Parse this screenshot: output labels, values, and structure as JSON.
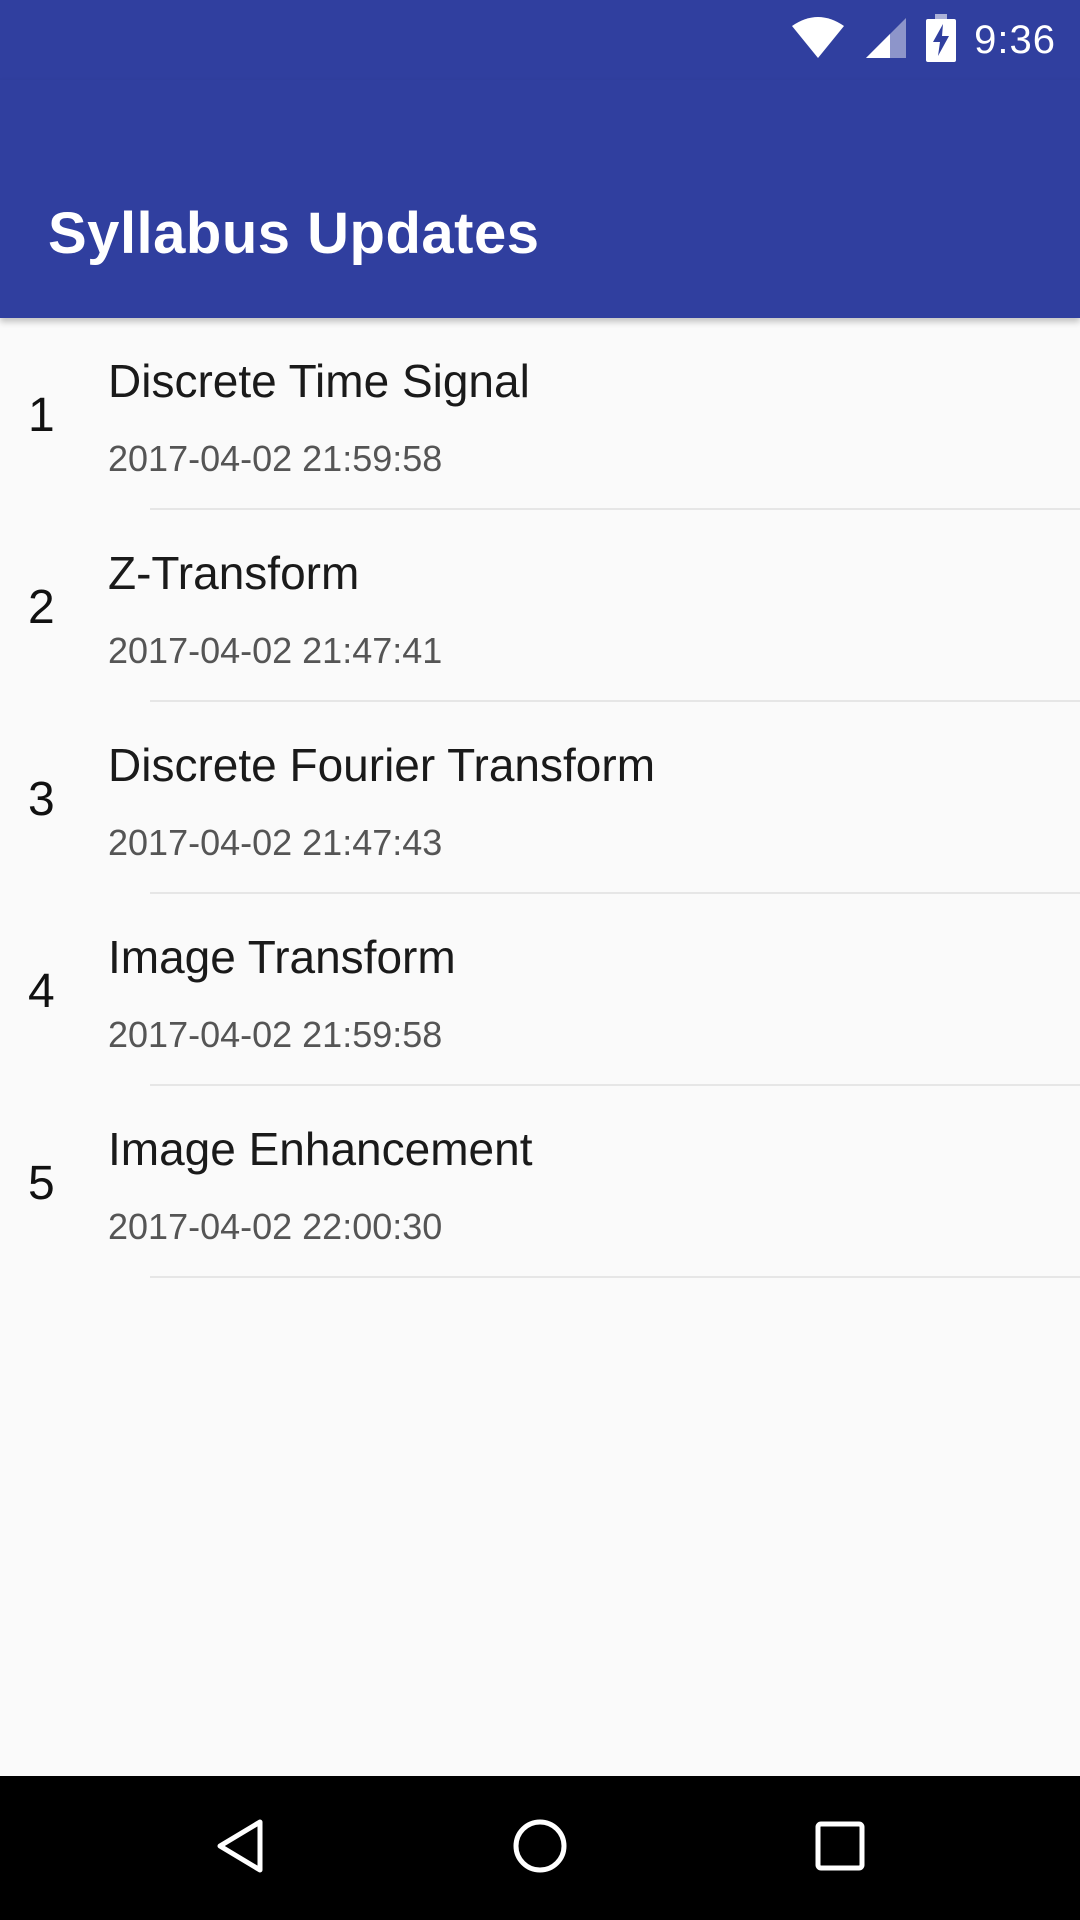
{
  "status_bar": {
    "time": "9:36",
    "icons": [
      "wifi-icon",
      "signal-icon",
      "battery-charging-icon"
    ]
  },
  "app_bar": {
    "title": "Syllabus Updates"
  },
  "items": [
    {
      "index": "1",
      "title": "Discrete Time Signal",
      "date": "2017-04-02 21:59:58"
    },
    {
      "index": "2",
      "title": "Z-Transform",
      "date": "2017-04-02 21:47:41"
    },
    {
      "index": "3",
      "title": "Discrete Fourier Transform",
      "date": "2017-04-02 21:47:43"
    },
    {
      "index": "4",
      "title": "Image Transform",
      "date": "2017-04-02 21:59:58"
    },
    {
      "index": "5",
      "title": "Image Enhancement",
      "date": "2017-04-02 22:00:30"
    }
  ],
  "nav_bar": {
    "buttons": [
      "back-icon",
      "home-icon",
      "recents-icon"
    ]
  },
  "colors": {
    "primary": "#303f9f",
    "background": "#fafafa",
    "nav_background": "#000000"
  }
}
